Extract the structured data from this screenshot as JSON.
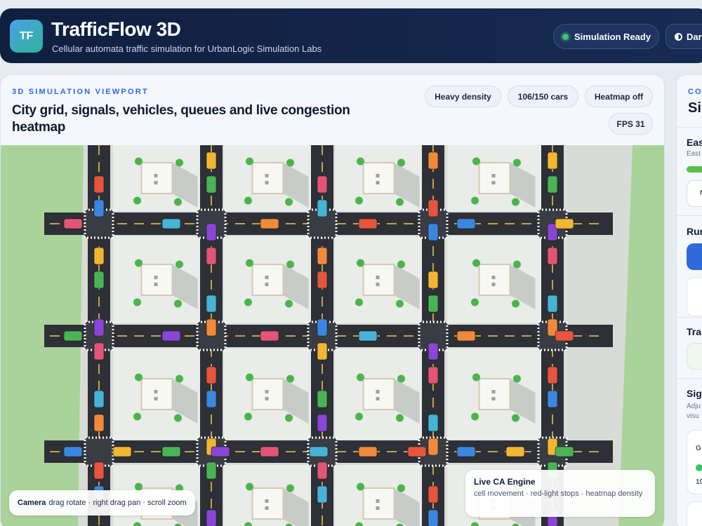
{
  "app": {
    "logo_text": "TF",
    "title": "TrafficFlow 3D",
    "subtitle": "Cellular automata traffic simulation for UrbanLogic Simulation Labs",
    "status_label": "Simulation Ready",
    "theme_label": "Dar"
  },
  "viewport": {
    "kicker": "3D SIMULATION VIEWPORT",
    "title": "City grid, signals, vehicles, queues and live congestion heatmap",
    "chips": {
      "density": "Heavy density",
      "cars": "106/150 cars",
      "heatmap": "Heatmap off",
      "fps": "FPS 31"
    },
    "camera_label": "Camera",
    "camera_hint": "drag rotate · right drag pan · scroll zoom",
    "engine_title": "Live CA Engine",
    "engine_desc": "cell movement · red-light stops · heatmap density"
  },
  "side_panel": {
    "kicker": "CO",
    "title": "Si",
    "section_1": "Eas",
    "section_1_sub": "East",
    "button_1": "N",
    "section_2": "Rur",
    "section_3": "Tra",
    "section_4": "Sig",
    "section_4_sub_1": "Adju",
    "section_4_sub_2": "visu",
    "card_label": "G",
    "card_value": "10"
  },
  "colors": {
    "header_bg": "#0f1f3f",
    "accent": "#2f6bd6",
    "status_green": "#3cc46b",
    "grass": "#a9d39a",
    "road": "#2e3038",
    "block": "#e9ece8"
  }
}
